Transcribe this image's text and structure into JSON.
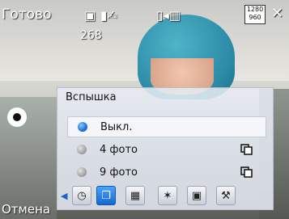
{
  "status": {
    "left_label": "Готово",
    "shots_remaining": "268",
    "icons": [
      "camera-icon",
      "mode-icon",
      "battery-icon",
      "resolution-icon",
      "close-icon"
    ],
    "resolution_badge_top": "1280",
    "resolution_badge_bottom": "960",
    "close_glyph": "✕"
  },
  "panel": {
    "title": "Вспышка",
    "options": [
      {
        "label": "Выкл.",
        "selected": true
      },
      {
        "label": "4 фото",
        "selected": false
      },
      {
        "label": "9 фото",
        "selected": false
      }
    ]
  },
  "toolbar": {
    "left_arrow": "◀",
    "right_arrow": "▶",
    "tools": [
      {
        "name": "timer-tool",
        "glyph": "◷"
      },
      {
        "name": "burst-tool",
        "glyph": "❐",
        "active": true
      },
      {
        "name": "frame-tool",
        "glyph": "▦"
      },
      {
        "name": "effect-tool",
        "glyph": "✶"
      },
      {
        "name": "scene-tool",
        "glyph": "▣"
      },
      {
        "name": "settings-tool",
        "glyph": "⚒"
      }
    ]
  },
  "bottom": {
    "cancel_label": "Отмена"
  }
}
